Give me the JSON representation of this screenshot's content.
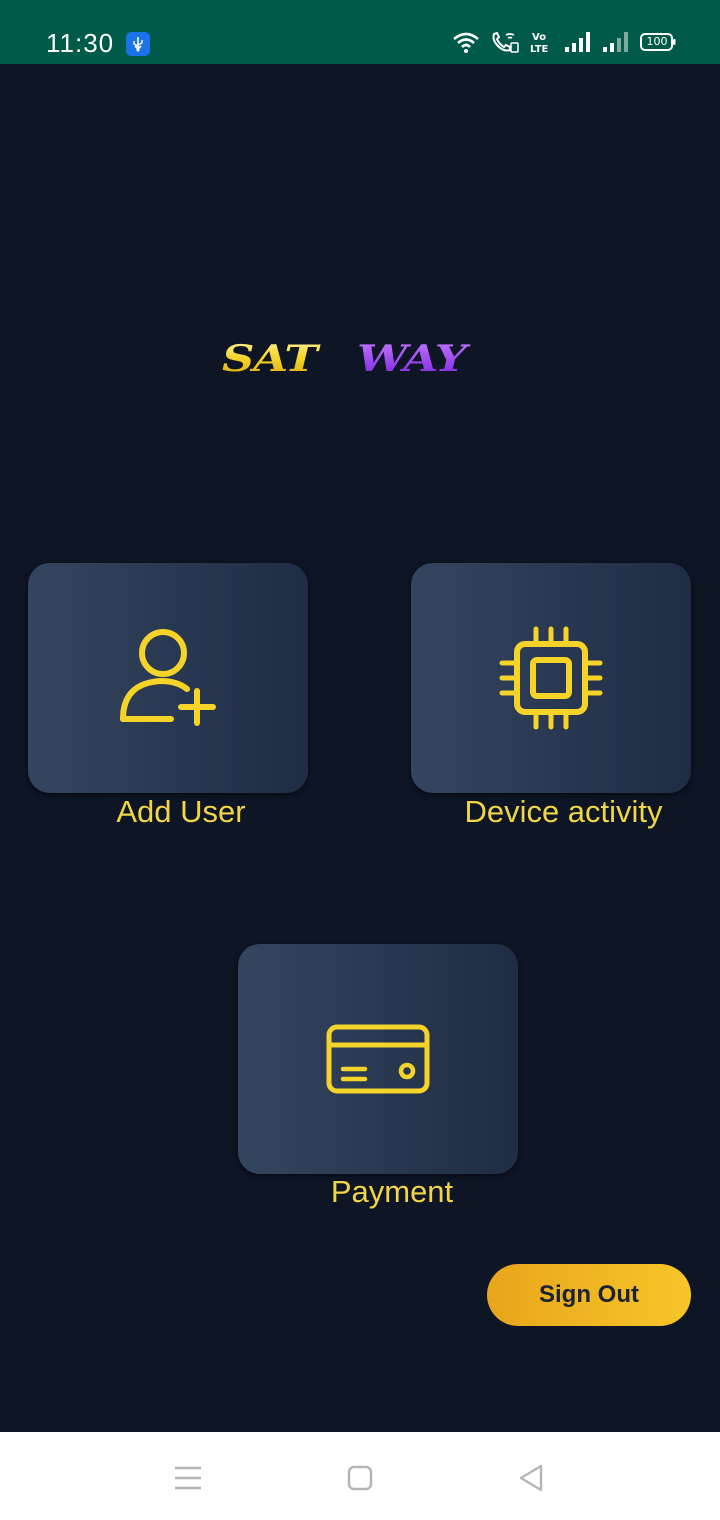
{
  "status_bar": {
    "time": "11:30",
    "battery": "100",
    "icons": [
      "usb-icon",
      "wifi-icon",
      "wifi-calling-icon",
      "volte-icon",
      "signal-icon",
      "signal-icon-2",
      "battery-icon"
    ],
    "background_color": "#005a4a"
  },
  "logo": {
    "text_left": "SAT",
    "text_right": "WAY",
    "color_left": "#f5d328",
    "color_right": "#9b3cf0"
  },
  "tiles": [
    {
      "id": "add_user",
      "label": "Add User",
      "icon": "add-user-icon"
    },
    {
      "id": "device_activity",
      "label": "Device activity",
      "icon": "chip-icon"
    },
    {
      "id": "payment",
      "label": "Payment",
      "icon": "credit-card-icon"
    }
  ],
  "sign_out": {
    "label": "Sign Out"
  },
  "nav_bar": {
    "icons": [
      "menu-icon",
      "home-square-icon",
      "back-triangle-icon"
    ]
  },
  "colors": {
    "background": "#0e1524",
    "accent_yellow": "#f1d548",
    "button_gradient_start": "#e8a51a",
    "button_gradient_end": "#f7c52a"
  }
}
